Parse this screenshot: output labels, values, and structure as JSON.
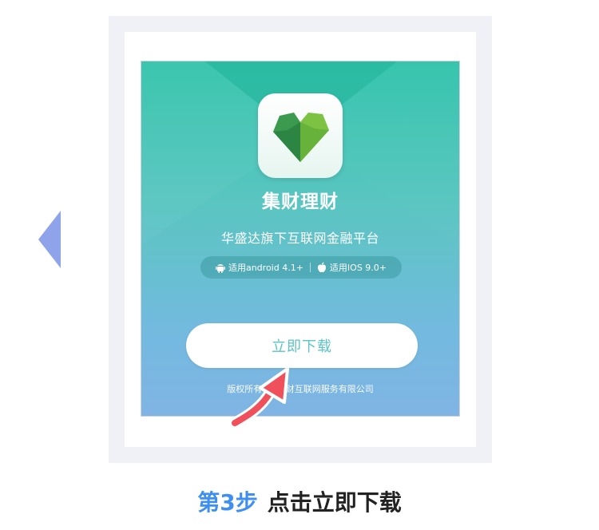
{
  "app": {
    "name": "集财理财",
    "tagline": "华盛达旗下互联网金融平台",
    "compat": {
      "android": "适用android 4.1+",
      "ios": "适用IOS 9.0+"
    },
    "download_label": "立即下载",
    "copyright": "版权所有©××财互联网服务有限公司"
  },
  "step": {
    "number": "第3步",
    "text": "点击立即下载"
  },
  "colors": {
    "accent": "#3f8ff2",
    "nav_arrow": "#8fa3ea",
    "gradient_top": "#2fc3aa",
    "gradient_bottom": "#7cb2e4",
    "pointer_arrow": "#f0505c"
  },
  "icons": {
    "prev": "triangle-left-icon",
    "app": "green-heart-logo-icon",
    "android": "android-icon",
    "ios": "apple-icon",
    "pointer": "curved-arrow-icon"
  }
}
